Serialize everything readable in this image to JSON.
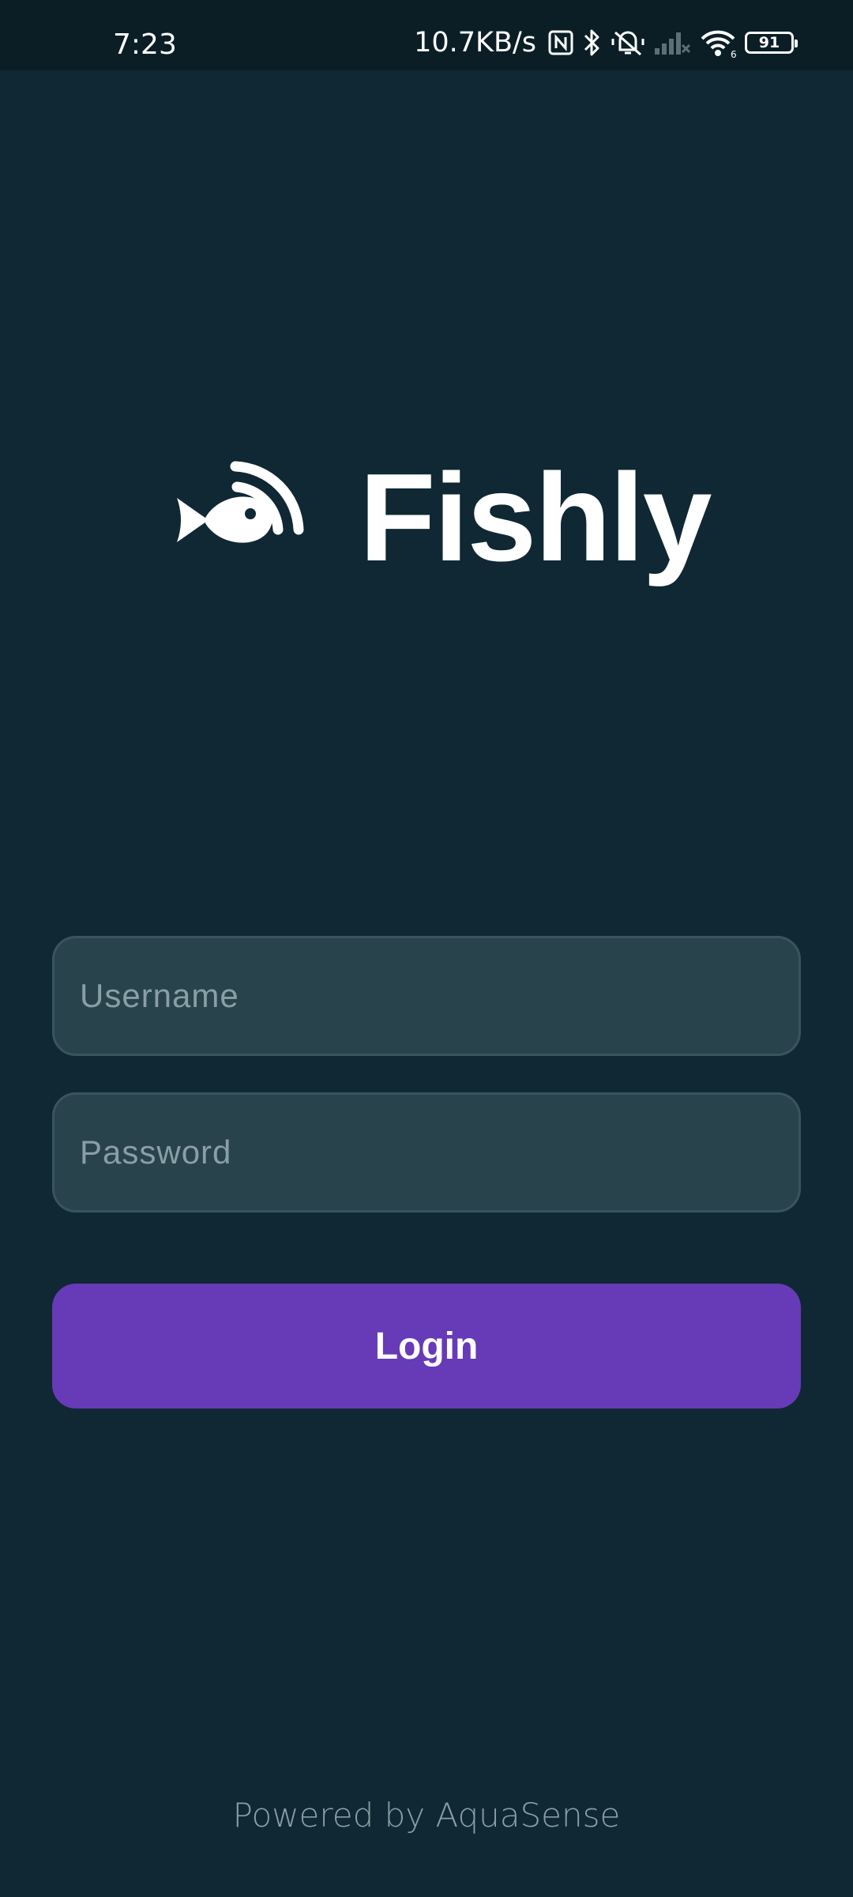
{
  "status_bar": {
    "time": "7:23",
    "net_speed": "10.7KB/s",
    "battery_level": "91",
    "icons": [
      "nfc-icon",
      "bluetooth-icon",
      "silent-icon",
      "signal-icon",
      "wifi-icon",
      "battery-icon"
    ]
  },
  "app": {
    "title": "Fishly",
    "logo_icon": "fish-signal-icon"
  },
  "login_form": {
    "username_placeholder": "Username",
    "username_value": "",
    "password_placeholder": "Password",
    "password_value": "",
    "login_label": "Login"
  },
  "footer": {
    "text": "Powered by AquaSense"
  },
  "colors": {
    "background": "#0f2833",
    "status_bar": "#0b1e26",
    "field_background": "#29434c",
    "accent": "#673ab7",
    "placeholder": "#8a9ea5"
  }
}
